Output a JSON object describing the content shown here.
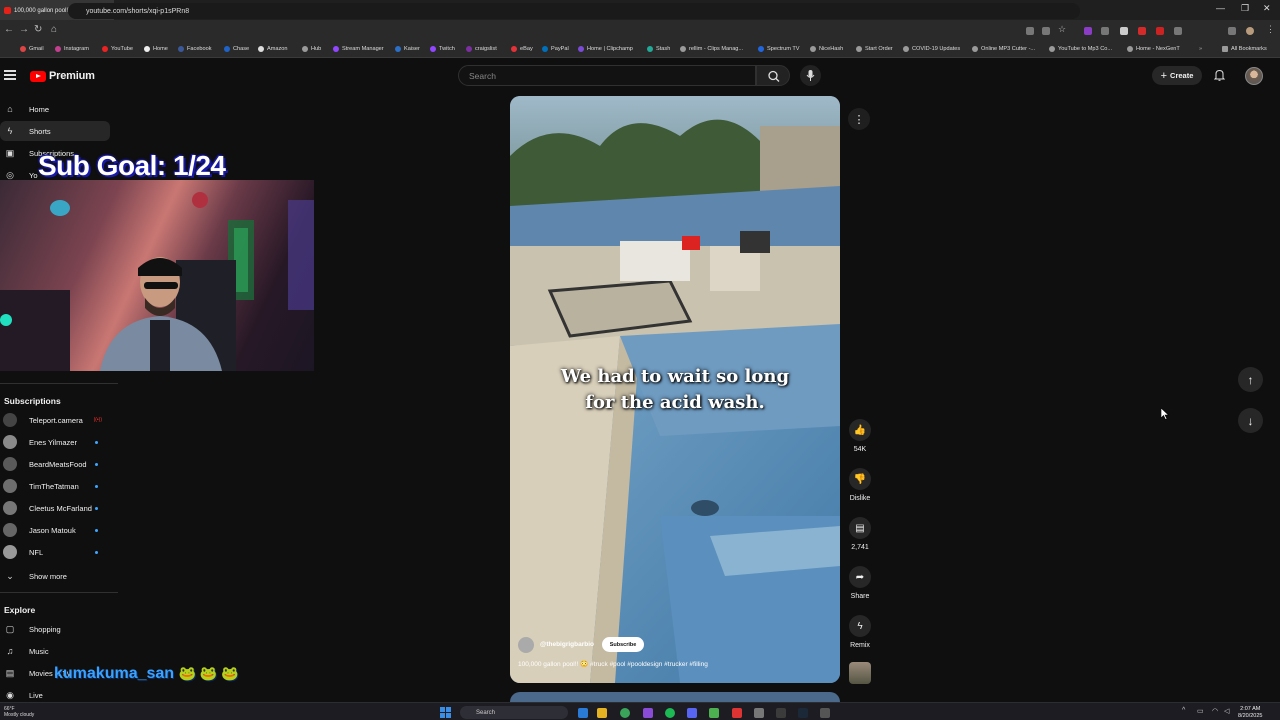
{
  "browser": {
    "tab_title": "100,000 gallon pool!! 😳 #tr",
    "url": "youtube.com/shorts/xqi-p1sPRn8",
    "bookmarks": [
      "Gmail",
      "Instagram",
      "YouTube",
      "Home",
      "Facebook",
      "Chase",
      "Amazon",
      "Hub",
      "Stream Manager",
      "Kaiser",
      "Twitch",
      "craigslist",
      "eBay",
      "PayPal",
      "Home | Clipchamp",
      "Stash",
      "rellim - Clips Manag...",
      "Spectrum TV",
      "NiceHash",
      "Start Order",
      "COVID-19 Updates",
      "Online MP3 Cutter -...",
      "YouTube to Mp3 Co...",
      "Home - NexGenT",
      "All Bookmarks"
    ]
  },
  "header": {
    "logo_text": "Premium",
    "search_placeholder": "Search",
    "create_label": "Create"
  },
  "sidebar": {
    "items": [
      "Home",
      "Shorts",
      "Subscriptions",
      "Yo"
    ],
    "subscriptions_heading": "Subscriptions",
    "channels": [
      "Teleport.camera",
      "Enes Yilmazer",
      "BeardMeatsFood",
      "TimTheTatman",
      "Cleetus McFarland",
      "Jason Matouk",
      "NFL"
    ],
    "show_more": "Show more",
    "explore_heading": "Explore",
    "explore_items": [
      "Shopping",
      "Music",
      "Movies & TV",
      "Live"
    ]
  },
  "overlay": {
    "sub_goal": "Sub Goal: 1/24",
    "streamer_name": "kumakuma_san"
  },
  "short": {
    "caption_line1": "We had to wait so long",
    "caption_line2": "for the acid wash.",
    "channel_handle": "@thebigrigbarbio",
    "subscribe_label": "Subscribe",
    "description": "100,000 gallon pool!! 😳 #truck #pool #pooldesign #trucker #filling",
    "likes": "54K",
    "dislike_label": "Dislike",
    "comments": "2,741",
    "share_label": "Share",
    "remix_label": "Remix"
  },
  "taskbar": {
    "weather_temp": "66°F",
    "weather_desc": "Mostly cloudy",
    "search_label": "Search",
    "time": "2:07 AM",
    "date": "8/20/2025"
  },
  "colors": {
    "yt_red": "#ff0000",
    "background": "#0f0f0f",
    "overlay_blue": "#39a2ff"
  }
}
